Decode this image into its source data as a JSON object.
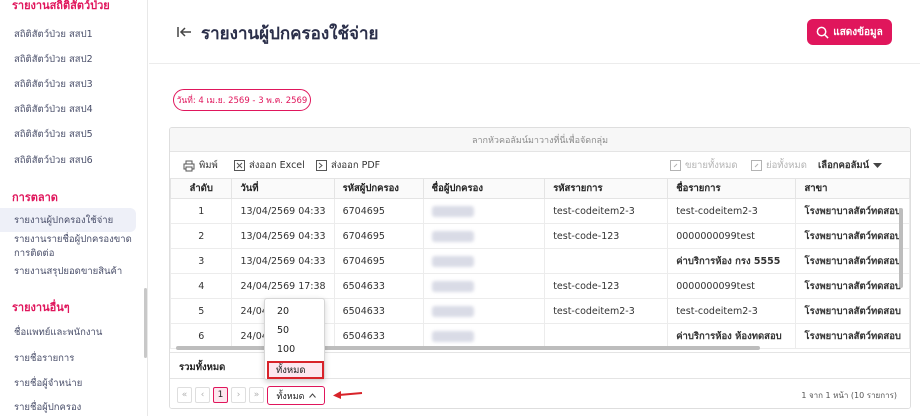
{
  "sidebar": {
    "top_heading": "รายงานสถิติสัตว์ป่วย",
    "stats_items": [
      "สถิติสัตว์ป่วย สสป1",
      "สถิติสัตว์ป่วย สสป2",
      "สถิติสัตว์ป่วย สสป3",
      "สถิติสัตว์ป่วย สสป4",
      "สถิติสัตว์ป่วย สสป5",
      "สถิติสัตว์ป่วย สสป6"
    ],
    "marketing_heading": "การตลาด",
    "marketing_items": [
      "รายงานผู้ปกครองใช้จ่าย",
      "รายงานรายชื่อผู้ปกครองขาด",
      "การติดต่อ",
      "รายงานสรุปยอดขายสินค้า"
    ],
    "other_heading": "รายงานอื่นๆ",
    "other_items": [
      "ชื่อแพทย์และพนักงาน",
      "รายชื่อรายการ",
      "รายชื่อผู้จำหน่าย",
      "รายชื่อผู้ปกครอง"
    ]
  },
  "header": {
    "title": "รายงานผู้ปกครองใช้จ่าย",
    "show_button": "แสดงข้อมูล"
  },
  "date_chip": "วันที่: 4 เม.ย. 2569 - 3 พ.ค. 2569",
  "grid": {
    "group_panel_hint": "ลากหัวคอลัมน์มาวางที่นี่เพื่อจัดกลุ่ม",
    "toolbar": {
      "print": "พิมพ์",
      "export_excel": "ส่งออก Excel",
      "export_pdf": "ส่งออก PDF",
      "expand_all": "ขยายทั้งหมด",
      "collapse_all": "ย่อทั้งหมด",
      "choose_columns": "เลือกคอลัมน์"
    },
    "columns": [
      "ลำดับ",
      "วันที่",
      "รหัสผู้ปกครอง",
      "ชื่อผู้ปกครอง",
      "รหัสรายการ",
      "ชื่อรายการ",
      "สาขา"
    ],
    "rows": [
      {
        "no": "1",
        "date": "13/04/2569 04:33",
        "owner_code": "6704695",
        "item_code": "test-codeitem2-3",
        "item_name": "test-codeitem2-3",
        "branch": "โรงพยาบาลสัตว์ทดสอบ"
      },
      {
        "no": "2",
        "date": "13/04/2569 04:33",
        "owner_code": "6704695",
        "item_code": "test-code-123",
        "item_name": "0000000099test",
        "branch": "โรงพยาบาลสัตว์ทดสอบ"
      },
      {
        "no": "3",
        "date": "13/04/2569 04:33",
        "owner_code": "6704695",
        "item_code": "",
        "item_name": "ค่าบริการห้อง กรง 5555",
        "branch": "โรงพยาบาลสัตว์ทดสอบ"
      },
      {
        "no": "4",
        "date": "24/04/2569 17:38",
        "owner_code": "6504633",
        "item_code": "test-code-123",
        "item_name": "0000000099test",
        "branch": "โรงพยาบาลสัตว์ทดสอบ"
      },
      {
        "no": "5",
        "date": "24/04/",
        "owner_code": "6504633",
        "item_code": "test-codeitem2-3",
        "item_name": "test-codeitem2-3",
        "branch": "โรงพยาบาลสัตว์ทดสอบ"
      },
      {
        "no": "6",
        "date": "24/04/",
        "owner_code": "6504633",
        "item_code": "",
        "item_name": "ค่าบริการห้อง ห้องทดสอบ",
        "branch": "โรงพยาบาลสัตว์ทดสอบ"
      }
    ],
    "total_label": "รวมทั้งหมด",
    "pager": {
      "first": "«",
      "prev": "‹",
      "current_page": "1",
      "next": "›",
      "last": "»",
      "page_size_value": "ทั้งหมด",
      "info": "1 จาก 1 หน้า (10 รายการ)"
    },
    "page_size_options": [
      "20",
      "50",
      "100",
      "ทั้งหมด"
    ]
  },
  "colors": {
    "accent": "#e0165c",
    "highlight_outline": "#d8232a"
  }
}
